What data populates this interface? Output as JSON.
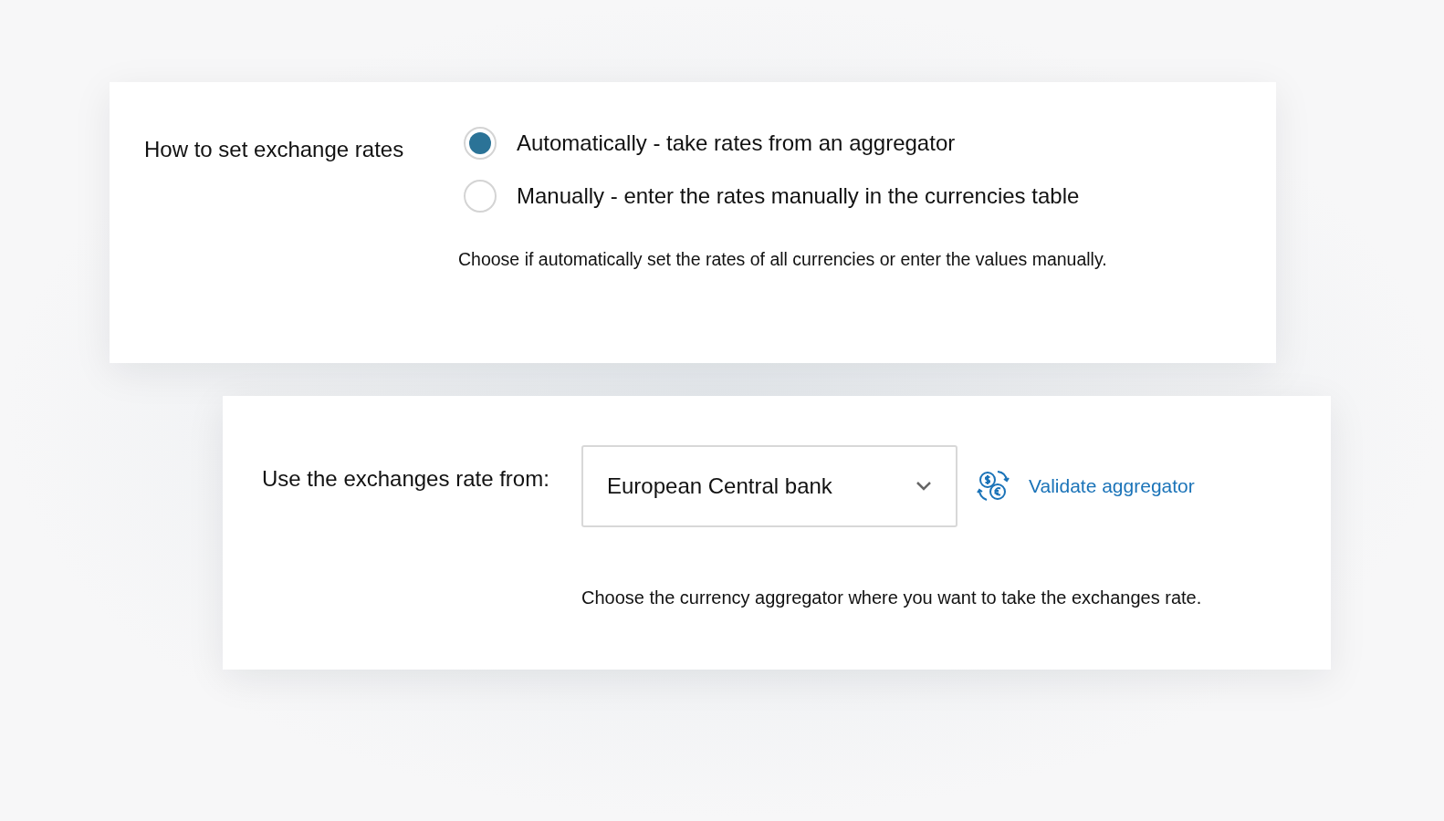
{
  "rate_mode": {
    "label": "How to set exchange rates",
    "options": [
      {
        "label": "Automatically - take rates from an aggregator",
        "selected": true
      },
      {
        "label": "Manually - enter the rates manually in the currencies table",
        "selected": false
      }
    ],
    "help": "Choose if automatically set the rates of all currencies or enter the values manually."
  },
  "aggregator": {
    "label": "Use the exchanges rate from:",
    "value": "European Central bank",
    "validate_link": "Validate aggregator",
    "help": "Choose the currency aggregator where you want to take the exchanges rate."
  }
}
